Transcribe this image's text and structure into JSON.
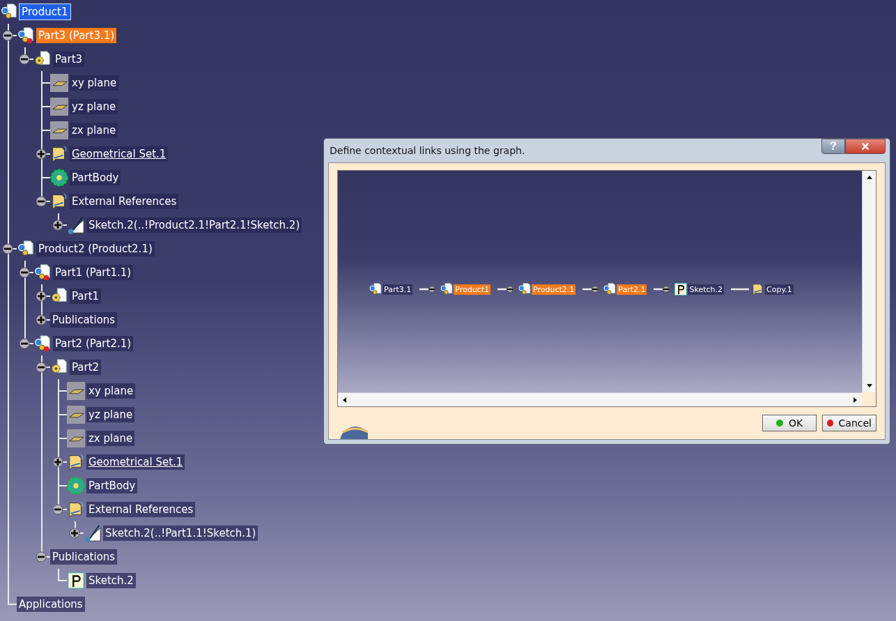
{
  "tree": {
    "label": "Product1",
    "kind": "product",
    "selected": true,
    "highlighted": false,
    "children": [
      {
        "label": "Part3 (Part3.1)",
        "kind": "component",
        "selected": false,
        "highlighted": true,
        "expanded": true,
        "children": [
          {
            "label": "Part3",
            "kind": "part",
            "selected": false,
            "highlighted": false,
            "expanded": true,
            "children": [
              {
                "label": "xy plane",
                "kind": "plane",
                "selected": false,
                "highlighted": false
              },
              {
                "label": "yz plane",
                "kind": "plane",
                "selected": false,
                "highlighted": false
              },
              {
                "label": "zx plane",
                "kind": "plane",
                "selected": false,
                "highlighted": false
              },
              {
                "label": "Geometrical Set.1",
                "kind": "geoset",
                "selected": false,
                "highlighted": false,
                "expanded": false,
                "underlined": true
              },
              {
                "label": "PartBody",
                "kind": "body",
                "selected": false,
                "highlighted": false
              },
              {
                "label": "External References",
                "kind": "geoset",
                "selected": false,
                "highlighted": false,
                "expanded": true,
                "children": [
                  {
                    "label": "Sketch.2(..!Product2.1!Part2.1!Sketch.2)",
                    "kind": "sketch",
                    "selected": false,
                    "highlighted": false,
                    "expanded": false
                  }
                ]
              }
            ]
          }
        ]
      },
      {
        "label": "Product2 (Product2.1)",
        "kind": "product",
        "selected": false,
        "highlighted": false,
        "expanded": true,
        "children": [
          {
            "label": "Part1 (Part1.1)",
            "kind": "component",
            "selected": false,
            "highlighted": false,
            "expanded": true,
            "children": [
              {
                "label": "Part1",
                "kind": "part",
                "selected": false,
                "highlighted": false,
                "expanded": false
              },
              {
                "label": "Publications",
                "kind": "none",
                "selected": false,
                "highlighted": false,
                "expanded": false
              }
            ]
          },
          {
            "label": "Part2 (Part2.1)",
            "kind": "component",
            "selected": false,
            "highlighted": false,
            "expanded": true,
            "children": [
              {
                "label": "Part2",
                "kind": "part",
                "selected": false,
                "highlighted": false,
                "expanded": true,
                "children": [
                  {
                    "label": "xy plane",
                    "kind": "plane",
                    "selected": false,
                    "highlighted": false
                  },
                  {
                    "label": "yz plane",
                    "kind": "plane",
                    "selected": false,
                    "highlighted": false
                  },
                  {
                    "label": "zx plane",
                    "kind": "plane",
                    "selected": false,
                    "highlighted": false
                  },
                  {
                    "label": "Geometrical Set.1",
                    "kind": "geoset",
                    "selected": false,
                    "highlighted": false,
                    "expanded": false,
                    "underlined": true
                  },
                  {
                    "label": "PartBody",
                    "kind": "body",
                    "selected": false,
                    "highlighted": false
                  },
                  {
                    "label": "External References",
                    "kind": "geoset",
                    "selected": false,
                    "highlighted": false,
                    "expanded": true,
                    "children": [
                      {
                        "label": "Sketch.2(..!Part1.1!Sketch.1)",
                        "kind": "sketch",
                        "selected": false,
                        "highlighted": false,
                        "expanded": false
                      }
                    ]
                  }
                ]
              },
              {
                "label": "Publications",
                "kind": "none",
                "selected": false,
                "highlighted": false,
                "expanded": true,
                "children": [
                  {
                    "label": "Sketch.2",
                    "kind": "publication",
                    "selected": false,
                    "highlighted": false
                  }
                ]
              }
            ]
          }
        ]
      },
      {
        "label": "Applications",
        "kind": "none",
        "selected": false,
        "highlighted": false
      }
    ]
  },
  "dialog": {
    "title": "Define contextual links using the graph.",
    "help_button": "?",
    "graph": [
      {
        "label": "Part3.1",
        "kind": "product",
        "highlighted": false
      },
      {
        "label": "Product1",
        "kind": "product",
        "highlighted": true,
        "knob": true
      },
      {
        "label": "Product2.1",
        "kind": "product",
        "highlighted": true,
        "knob": true
      },
      {
        "label": "Part2.1",
        "kind": "product",
        "highlighted": true,
        "knob": true
      },
      {
        "label": "Sketch.2",
        "kind": "publication",
        "highlighted": false,
        "knob": true
      },
      {
        "label": "Copy.1",
        "kind": "geoset",
        "highlighted": false,
        "knob": false
      }
    ],
    "buttons": [
      {
        "label": "OK",
        "kind": "ok"
      },
      {
        "label": "Cancel",
        "kind": "cancel"
      }
    ]
  }
}
